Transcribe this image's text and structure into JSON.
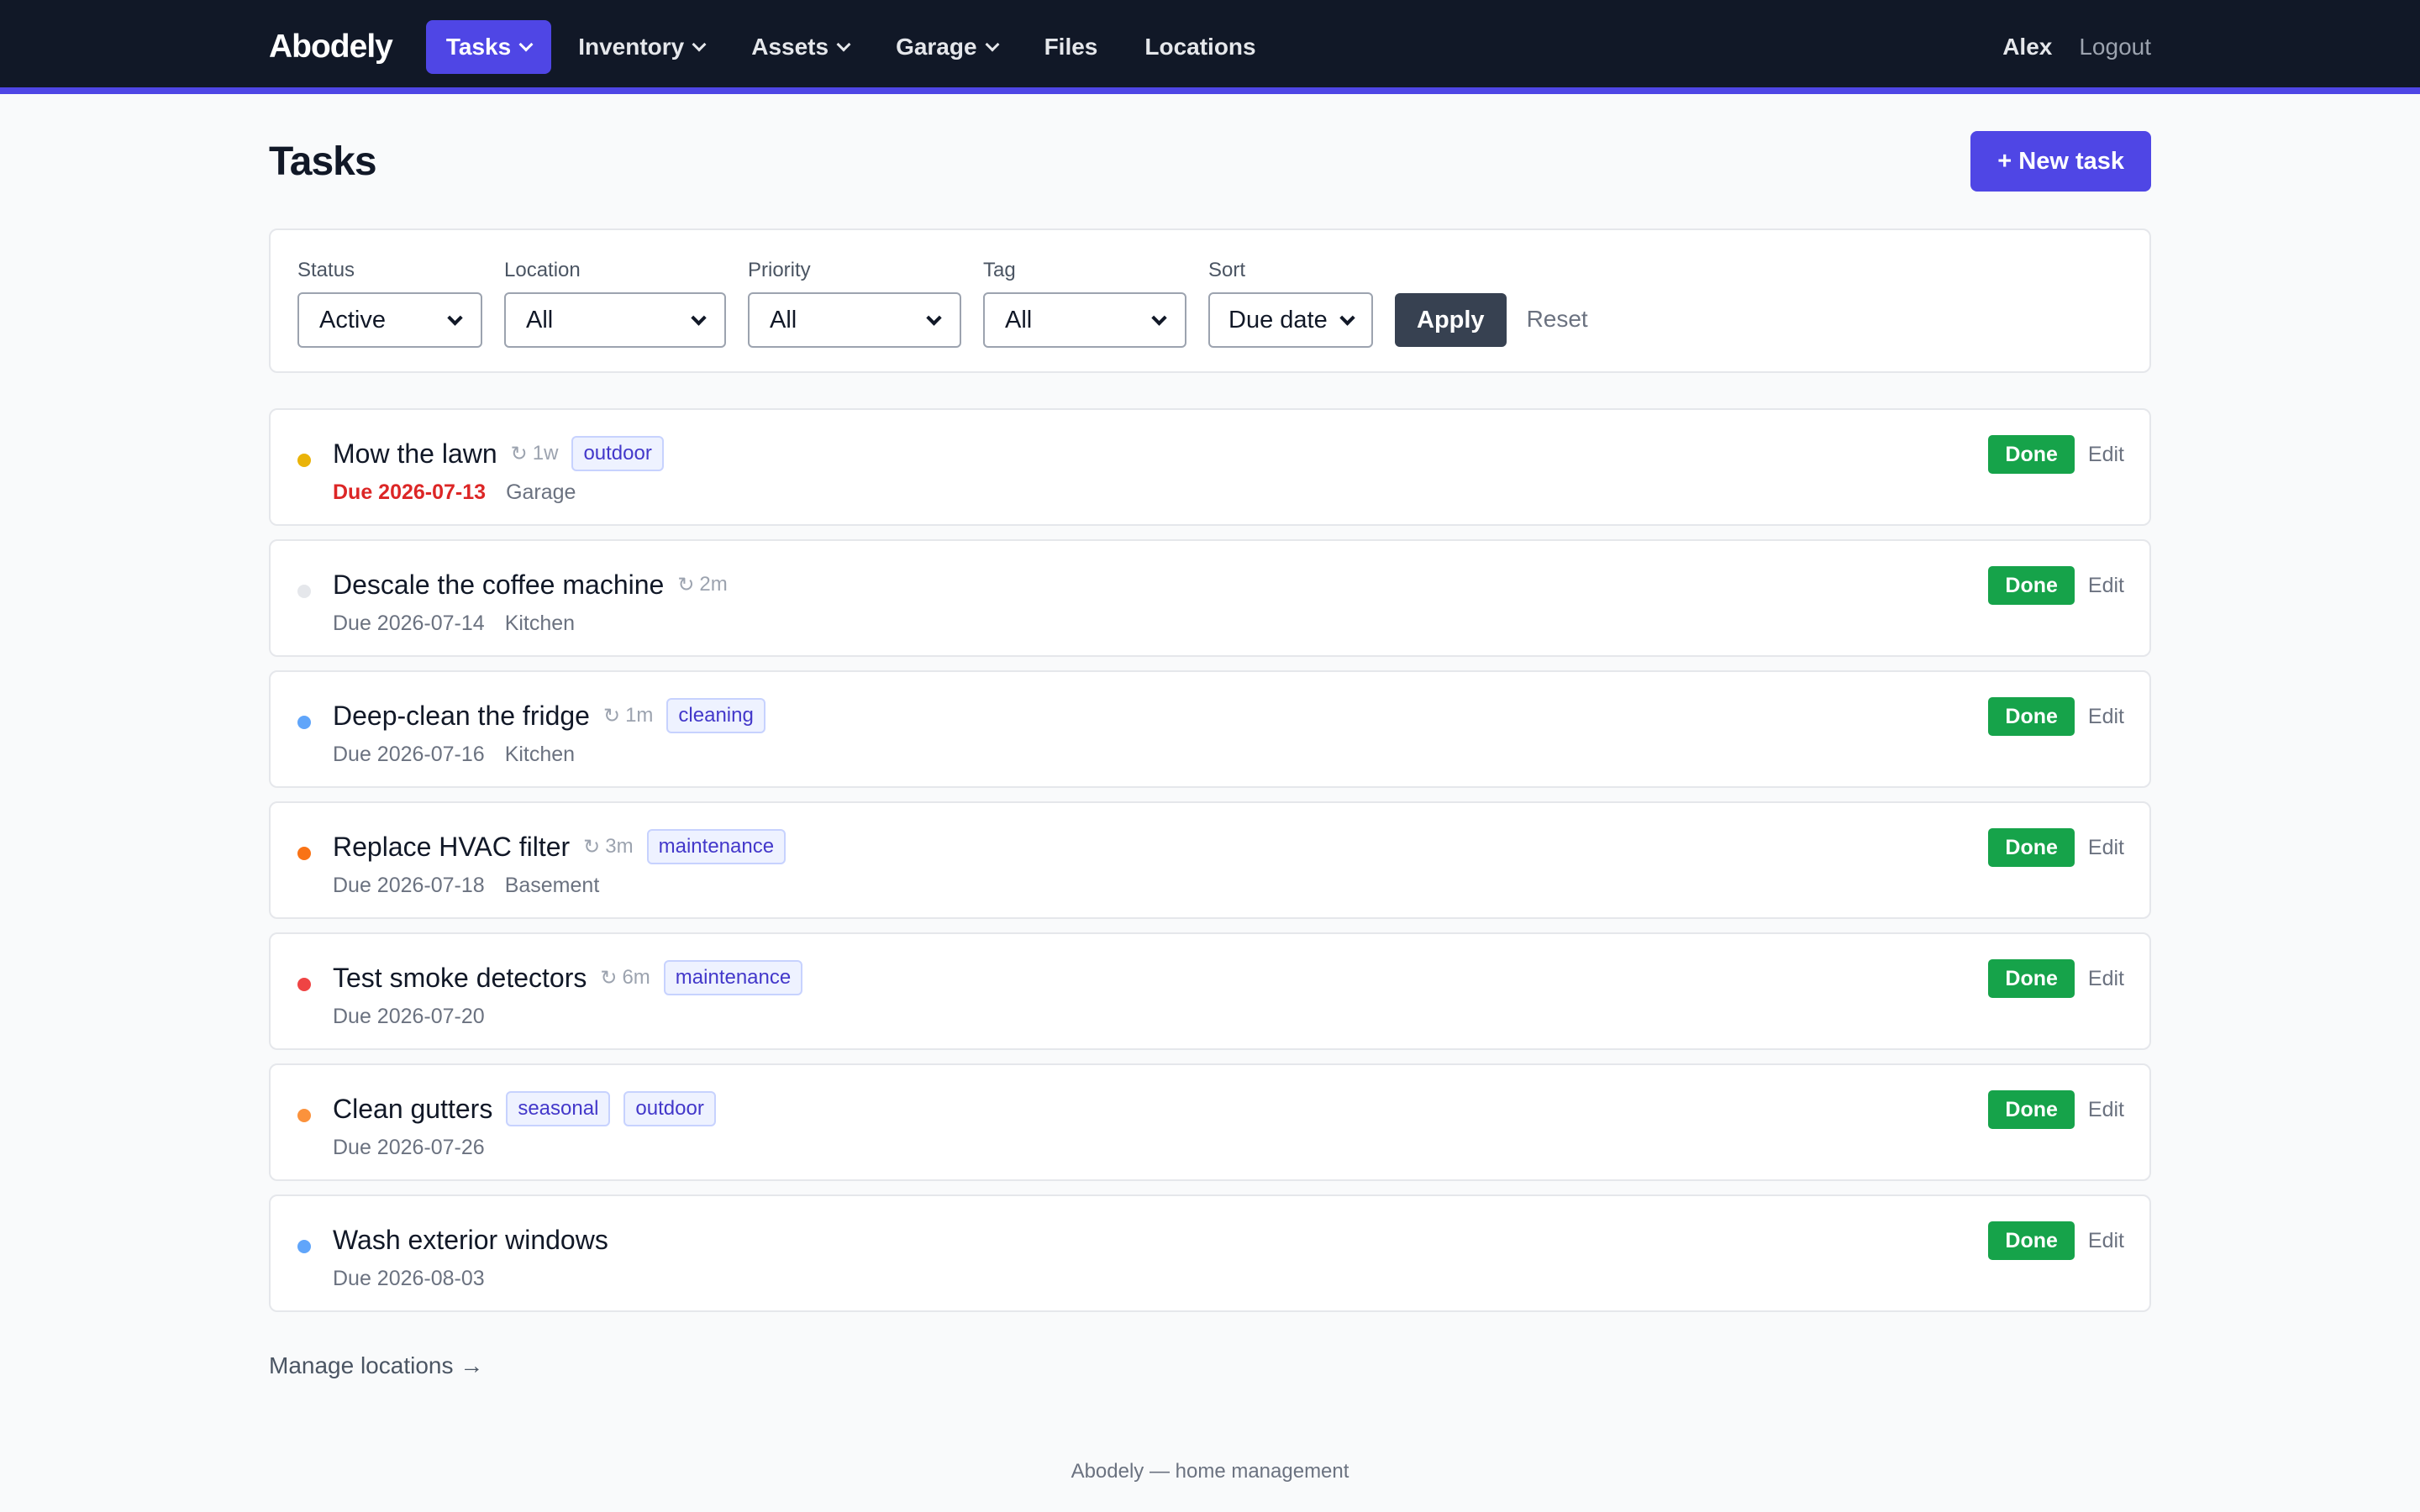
{
  "nav": {
    "brand": "Abodely",
    "items": [
      {
        "label": "Tasks",
        "dropdown": true,
        "active": true
      },
      {
        "label": "Inventory",
        "dropdown": true,
        "active": false
      },
      {
        "label": "Assets",
        "dropdown": true,
        "active": false
      },
      {
        "label": "Garage",
        "dropdown": true,
        "active": false
      },
      {
        "label": "Files",
        "dropdown": false,
        "active": false
      },
      {
        "label": "Locations",
        "dropdown": false,
        "active": false
      }
    ],
    "user": "Alex",
    "logout": "Logout"
  },
  "page": {
    "title": "Tasks",
    "new_task_label": "+ New task"
  },
  "filters": {
    "status": {
      "label": "Status",
      "value": "Active"
    },
    "location": {
      "label": "Location",
      "value": "All"
    },
    "priority": {
      "label": "Priority",
      "value": "All"
    },
    "tag": {
      "label": "Tag",
      "value": "All"
    },
    "sort": {
      "label": "Sort",
      "value": "Due date"
    },
    "apply_label": "Apply",
    "reset_label": "Reset"
  },
  "tasks": [
    {
      "title": "Mow the lawn",
      "recur": "1w",
      "tags": [
        "outdoor"
      ],
      "due": "Due 2026-07-13",
      "overdue": true,
      "location": "Garage",
      "priority_color": "#eab308"
    },
    {
      "title": "Descale the coffee machine",
      "recur": "2m",
      "tags": [],
      "due": "Due 2026-07-14",
      "overdue": false,
      "location": "Kitchen",
      "priority_color": "#e5e7eb"
    },
    {
      "title": "Deep-clean the fridge",
      "recur": "1m",
      "tags": [
        "cleaning"
      ],
      "due": "Due 2026-07-16",
      "overdue": false,
      "location": "Kitchen",
      "priority_color": "#60a5fa"
    },
    {
      "title": "Replace HVAC filter",
      "recur": "3m",
      "tags": [
        "maintenance"
      ],
      "due": "Due 2026-07-18",
      "overdue": false,
      "location": "Basement",
      "priority_color": "#f97316"
    },
    {
      "title": "Test smoke detectors",
      "recur": "6m",
      "tags": [
        "maintenance"
      ],
      "due": "Due 2026-07-20",
      "overdue": false,
      "location": "",
      "priority_color": "#ef4444"
    },
    {
      "title": "Clean gutters",
      "recur": "",
      "tags": [
        "seasonal",
        "outdoor"
      ],
      "due": "Due 2026-07-26",
      "overdue": false,
      "location": "",
      "priority_color": "#fb923c"
    },
    {
      "title": "Wash exterior windows",
      "recur": "",
      "tags": [],
      "due": "Due 2026-08-03",
      "overdue": false,
      "location": "",
      "priority_color": "#60a5fa"
    }
  ],
  "task_actions": {
    "done_label": "Done",
    "edit_label": "Edit"
  },
  "manage_locations": "Manage locations →",
  "footer": "Abodely — home management",
  "colors": {
    "accent": "#4f46e5",
    "nav_bg": "#111827",
    "done_green": "#16a34a",
    "overdue_red": "#dc2626"
  }
}
